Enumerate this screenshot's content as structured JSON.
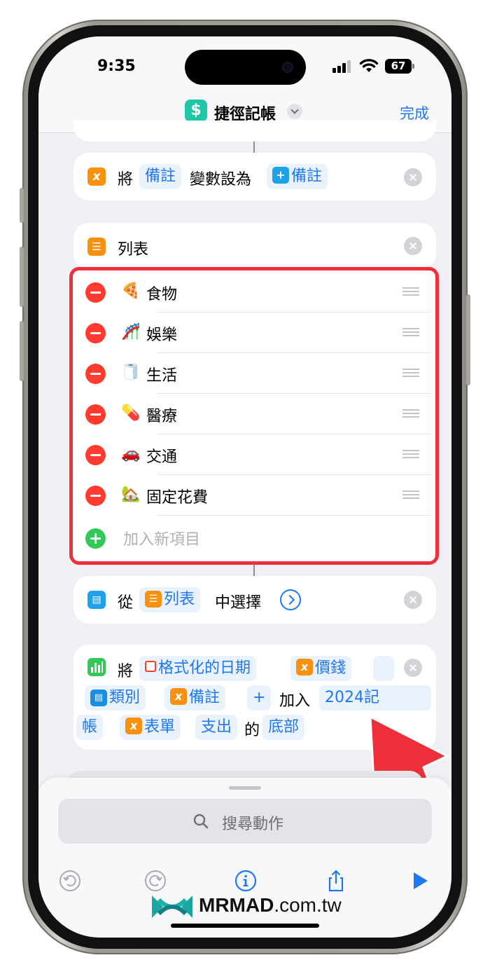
{
  "status": {
    "time": "9:35",
    "battery": "67"
  },
  "nav": {
    "app_icon": "$",
    "title": "捷徑記帳",
    "done": "完成"
  },
  "set_var": {
    "verb": "將",
    "var_name": "備註",
    "middle": "變數設為",
    "value": "備註"
  },
  "list_action": {
    "title": "列表",
    "items": [
      {
        "emoji": "🍕",
        "label": "食物"
      },
      {
        "emoji": "🎢",
        "label": "娛樂"
      },
      {
        "emoji": "🧻",
        "label": "生活"
      },
      {
        "emoji": "💊",
        "label": "醫療"
      },
      {
        "emoji": "🚗",
        "label": "交通"
      },
      {
        "emoji": "🏡",
        "label": "固定花費"
      }
    ],
    "add_item": "加入新項目"
  },
  "choose_action": {
    "from": "從",
    "list": "列表",
    "text": "中選擇"
  },
  "append_action": {
    "verb": "將",
    "date_token": "格式化的日期",
    "price_token": "價錢",
    "category_token": "類別",
    "note_token": "備註",
    "plus": "+",
    "add_text": "加入",
    "sheet_token_1": "2024記",
    "sheet_token_2": "帳",
    "form_token": "表單",
    "expense_token": "支出",
    "of_text": "的",
    "position_token": "底部"
  },
  "search": {
    "placeholder": "搜尋動作"
  },
  "toolbar": {
    "icons": [
      "undo-icon",
      "redo-icon",
      "info-icon",
      "share-icon",
      "play-icon"
    ]
  },
  "watermark": {
    "brand_bold": "MRMAD",
    "brand_light": ".com.tw"
  },
  "colors": {
    "accent": "#1e78f0",
    "highlight_border": "#ef2f3a",
    "delete": "#ff3b30",
    "add": "#34c759",
    "orange_icon": "#f9900e"
  }
}
